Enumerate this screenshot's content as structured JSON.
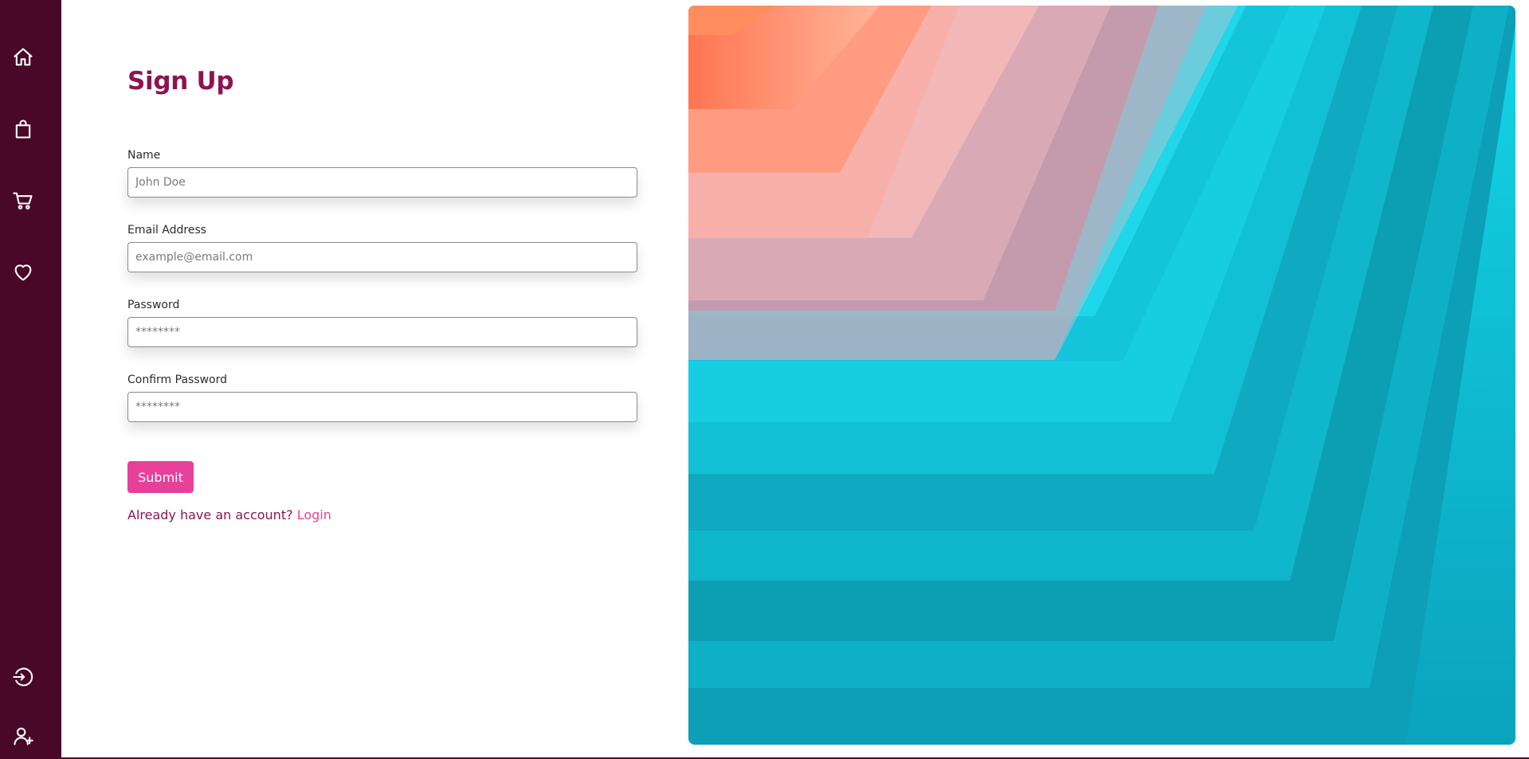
{
  "sidebar": {
    "items": [
      {
        "icon": "home-icon",
        "name": "nav-home"
      },
      {
        "icon": "shopping-bag-icon",
        "name": "nav-shop"
      },
      {
        "icon": "cart-icon",
        "name": "nav-cart"
      },
      {
        "icon": "heart-icon",
        "name": "nav-favorites"
      }
    ],
    "bottom_items": [
      {
        "icon": "login-icon",
        "name": "nav-login"
      },
      {
        "icon": "add-user-icon",
        "name": "nav-signup"
      }
    ]
  },
  "form": {
    "title": "Sign Up",
    "fields": {
      "name": {
        "label": "Name",
        "placeholder": "John Doe",
        "value": ""
      },
      "email": {
        "label": "Email Address",
        "placeholder": "example@email.com",
        "value": ""
      },
      "password": {
        "label": "Password",
        "placeholder": "********",
        "value": ""
      },
      "confirm_password": {
        "label": "Confirm Password",
        "placeholder": "********",
        "value": ""
      }
    },
    "submit_label": "Submit",
    "account_prompt": "Already have an account?",
    "login_link": "Login"
  },
  "hero": {
    "description": "abstract layered paper image"
  },
  "colors": {
    "sidebar_bg": "#4a0828",
    "accent": "#e6409a",
    "title": "#8d1452"
  }
}
